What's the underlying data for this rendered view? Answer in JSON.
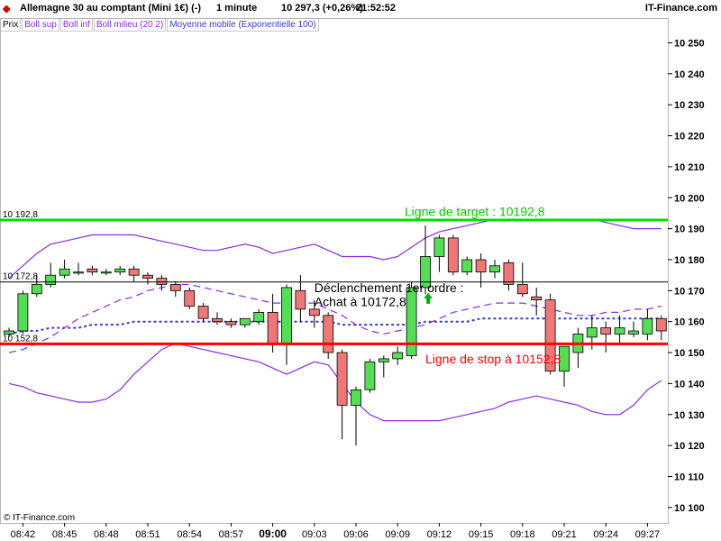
{
  "header": {
    "title": "Allemagne 30 au comptant (Mini 1€) (-)",
    "period": "1 minute",
    "price": "10 297,3 (+0,26%)",
    "time": "21:52:52",
    "brand": "IT-Finance.com"
  },
  "legend": [
    {
      "label": "Prix",
      "color": "#000000"
    },
    {
      "label": "Boll sup",
      "color": "#8a2be2"
    },
    {
      "label": "Boll inf",
      "color": "#8a2be2"
    },
    {
      "label": "Boll milieu (20 2)",
      "color": "#8a2be2"
    },
    {
      "label": "Moyenne mobile (Exponentielle 100)",
      "color": "#3a3acc"
    }
  ],
  "footer": {
    "copyright": "© IT-Finance.com"
  },
  "chart_data": {
    "type": "candlestick",
    "ylim": [
      10095,
      10258
    ],
    "y_ticks": [
      10100,
      10110,
      10120,
      10130,
      10140,
      10150,
      10160,
      10170,
      10180,
      10190,
      10200,
      10210,
      10220,
      10230,
      10240,
      10250
    ],
    "y_tick_labels": [
      "10 100",
      "10 110",
      "10 120",
      "10 130",
      "10 140",
      "10 150",
      "10 160",
      "10 170",
      "10 180",
      "10 190",
      "10 200",
      "10 210",
      "10 220",
      "10 230",
      "10 240",
      "10 250"
    ],
    "x_tick_labels": [
      {
        "i": 1,
        "label": "08:42",
        "bold": false
      },
      {
        "i": 4,
        "label": "08:45",
        "bold": false
      },
      {
        "i": 7,
        "label": "08:48",
        "bold": false
      },
      {
        "i": 10,
        "label": "08:51",
        "bold": false
      },
      {
        "i": 13,
        "label": "08:54",
        "bold": false
      },
      {
        "i": 16,
        "label": "08:57",
        "bold": false
      },
      {
        "i": 19,
        "label": "09:00",
        "bold": true
      },
      {
        "i": 22,
        "label": "09:03",
        "bold": false
      },
      {
        "i": 25,
        "label": "09:06",
        "bold": false
      },
      {
        "i": 28,
        "label": "09:09",
        "bold": false
      },
      {
        "i": 31,
        "label": "09:12",
        "bold": false
      },
      {
        "i": 34,
        "label": "09:15",
        "bold": false
      },
      {
        "i": 37,
        "label": "09:18",
        "bold": false
      },
      {
        "i": 40,
        "label": "09:21",
        "bold": false
      },
      {
        "i": 43,
        "label": "09:24",
        "bold": false
      },
      {
        "i": 46,
        "label": "09:27",
        "bold": false
      }
    ],
    "candles": [
      {
        "o": 10156,
        "h": 10158,
        "l": 10155,
        "c": 10157
      },
      {
        "o": 10157,
        "h": 10170,
        "l": 10156,
        "c": 10169
      },
      {
        "o": 10169,
        "h": 10175,
        "l": 10168,
        "c": 10172
      },
      {
        "o": 10172,
        "h": 10179,
        "l": 10171,
        "c": 10175
      },
      {
        "o": 10175,
        "h": 10180,
        "l": 10174,
        "c": 10177
      },
      {
        "o": 10176,
        "h": 10179,
        "l": 10175,
        "c": 10176
      },
      {
        "o": 10177,
        "h": 10178,
        "l": 10175,
        "c": 10176
      },
      {
        "o": 10176,
        "h": 10177,
        "l": 10175,
        "c": 10176
      },
      {
        "o": 10176,
        "h": 10178,
        "l": 10175,
        "c": 10177
      },
      {
        "o": 10177,
        "h": 10178,
        "l": 10173,
        "c": 10175
      },
      {
        "o": 10175,
        "h": 10176,
        "l": 10172,
        "c": 10174
      },
      {
        "o": 10174,
        "h": 10175,
        "l": 10170,
        "c": 10172
      },
      {
        "o": 10172,
        "h": 10173,
        "l": 10168,
        "c": 10170
      },
      {
        "o": 10170,
        "h": 10171,
        "l": 10164,
        "c": 10165
      },
      {
        "o": 10165,
        "h": 10166,
        "l": 10160,
        "c": 10161
      },
      {
        "o": 10161,
        "h": 10163,
        "l": 10159,
        "c": 10160
      },
      {
        "o": 10160,
        "h": 10161,
        "l": 10158,
        "c": 10159
      },
      {
        "o": 10159,
        "h": 10161,
        "l": 10158,
        "c": 10161
      },
      {
        "o": 10160,
        "h": 10164,
        "l": 10159,
        "c": 10163
      },
      {
        "o": 10163,
        "h": 10169,
        "l": 10150,
        "c": 10153
      },
      {
        "o": 10153,
        "h": 10172,
        "l": 10146,
        "c": 10171
      },
      {
        "o": 10170,
        "h": 10175,
        "l": 10160,
        "c": 10164
      },
      {
        "o": 10164,
        "h": 10167,
        "l": 10158,
        "c": 10162
      },
      {
        "o": 10162,
        "h": 10163,
        "l": 10148,
        "c": 10150
      },
      {
        "o": 10150,
        "h": 10151,
        "l": 10122,
        "c": 10133
      },
      {
        "o": 10133,
        "h": 10139,
        "l": 10120,
        "c": 10138
      },
      {
        "o": 10138,
        "h": 10148,
        "l": 10137,
        "c": 10147
      },
      {
        "o": 10147,
        "h": 10149,
        "l": 10142,
        "c": 10148
      },
      {
        "o": 10148,
        "h": 10152,
        "l": 10146,
        "c": 10150
      },
      {
        "o": 10149,
        "h": 10173,
        "l": 10148,
        "c": 10171
      },
      {
        "o": 10171,
        "h": 10191,
        "l": 10169,
        "c": 10181
      },
      {
        "o": 10181,
        "h": 10188,
        "l": 10176,
        "c": 10187
      },
      {
        "o": 10187,
        "h": 10188,
        "l": 10175,
        "c": 10176
      },
      {
        "o": 10176,
        "h": 10181,
        "l": 10175,
        "c": 10180
      },
      {
        "o": 10180,
        "h": 10182,
        "l": 10171,
        "c": 10176
      },
      {
        "o": 10176,
        "h": 10180,
        "l": 10174,
        "c": 10178
      },
      {
        "o": 10179,
        "h": 10180,
        "l": 10170,
        "c": 10172
      },
      {
        "o": 10172,
        "h": 10179,
        "l": 10168,
        "c": 10169
      },
      {
        "o": 10168,
        "h": 10171,
        "l": 10162,
        "c": 10167
      },
      {
        "o": 10167,
        "h": 10169,
        "l": 10143,
        "c": 10144
      },
      {
        "o": 10144,
        "h": 10152,
        "l": 10139,
        "c": 10152
      },
      {
        "o": 10150,
        "h": 10158,
        "l": 10145,
        "c": 10156
      },
      {
        "o": 10155,
        "h": 10162,
        "l": 10151,
        "c": 10158
      },
      {
        "o": 10158,
        "h": 10160,
        "l": 10150,
        "c": 10156
      },
      {
        "o": 10156,
        "h": 10162,
        "l": 10153,
        "c": 10158
      },
      {
        "o": 10156,
        "h": 10160,
        "l": 10155,
        "c": 10157
      },
      {
        "o": 10156,
        "h": 10164,
        "l": 10154,
        "c": 10161
      },
      {
        "o": 10161,
        "h": 10162,
        "l": 10154,
        "c": 10157
      }
    ],
    "bollinger": {
      "upper": [
        10174,
        10178,
        10182,
        10185,
        10186,
        10187,
        10188,
        10188,
        10188,
        10188,
        10187,
        10186,
        10185,
        10184,
        10183,
        10183,
        10184,
        10185,
        10184,
        10182,
        10183,
        10184,
        10185,
        10183,
        10181,
        10181,
        10181,
        10180,
        10181,
        10184,
        10187,
        10189,
        10190,
        10191,
        10192,
        10193,
        10193,
        10193,
        10193,
        10193,
        10193,
        10193,
        10193,
        10192,
        10191,
        10190,
        10190,
        10190
      ],
      "middle": [
        10150,
        10151,
        10153,
        10155,
        10158,
        10161,
        10163,
        10165,
        10167,
        10168,
        10170,
        10171,
        10172,
        10172,
        10171,
        10170,
        10169,
        10168,
        10167,
        10166,
        10166,
        10166,
        10166,
        10164,
        10162,
        10159,
        10157,
        10156,
        10157,
        10158,
        10159,
        10161,
        10163,
        10164,
        10165,
        10166,
        10166,
        10166,
        10165,
        10164,
        10163,
        10162,
        10162,
        10163,
        10163,
        10164,
        10164,
        10165
      ],
      "lower": [
        10140,
        10139,
        10137,
        10136,
        10135,
        10134,
        10134,
        10135,
        10138,
        10143,
        10147,
        10151,
        10153,
        10152,
        10151,
        10150,
        10149,
        10148,
        10147,
        10145,
        10143,
        10145,
        10147,
        10146,
        10140,
        10134,
        10130,
        10128,
        10128,
        10128,
        10128,
        10128,
        10129,
        10130,
        10131,
        10132,
        10134,
        10135,
        10136,
        10135,
        10134,
        10133,
        10131,
        10130,
        10130,
        10133,
        10138,
        10141
      ]
    },
    "ema100": [
      10156,
      10157,
      10157,
      10158,
      10158,
      10158,
      10159,
      10159,
      10159,
      10160,
      10160,
      10160,
      10160,
      10160,
      10160,
      10160,
      10160,
      10160,
      10160,
      10160,
      10160,
      10160,
      10160,
      10160,
      10159,
      10159,
      10159,
      10159,
      10159,
      10159,
      10160,
      10160,
      10160,
      10160,
      10161,
      10161,
      10161,
      10161,
      10161,
      10161,
      10161,
      10161,
      10161,
      10161,
      10161,
      10161,
      10161,
      10161
    ],
    "hlines": [
      {
        "value": 10192.8,
        "label": "10 192,8",
        "color": "#00e000",
        "width": 3
      },
      {
        "value": 10172.8,
        "label": "10 172,8",
        "color": "#000000",
        "width": 1
      },
      {
        "value": 10152.8,
        "label": "10 152,8",
        "color": "#ff0000",
        "width": 3
      }
    ],
    "annotations": [
      {
        "text": "Ligne de target : 10192,8",
        "value": 10195.5,
        "i": 28.5,
        "color": "#00cc00"
      },
      {
        "text": "Déclenchement 1er ordre :",
        "value": 10171,
        "i": 22,
        "color": "#000000"
      },
      {
        "text": "Achat à 10172,8",
        "value": 10166.5,
        "i": 22,
        "color": "#000000"
      },
      {
        "text": "Ligne de stop à 10152,8",
        "value": 10148,
        "i": 30,
        "color": "#ff0000"
      }
    ],
    "signal": {
      "i": 30.2,
      "value": 10167.5,
      "direction": "up",
      "color": "#00b000"
    }
  }
}
